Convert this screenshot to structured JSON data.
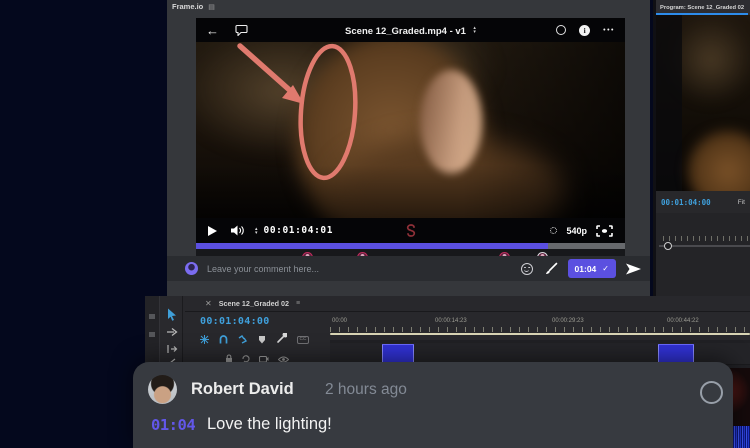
{
  "frameio": {
    "app_title": "Frame.io",
    "player": {
      "title": "Scene 12_Graded.mp4 - v1",
      "timecode": "00:01:04:01",
      "quality": "540p",
      "progress_percent": 82,
      "markers": [
        {
          "position_percent": 24.6,
          "ring_color": "#c02c5e"
        },
        {
          "position_percent": 37.6,
          "ring_color": "#c02c5e"
        },
        {
          "position_percent": 70.7,
          "ring_color": "#c02c5e"
        },
        {
          "position_percent": 79.6,
          "ring_color": "#d8dade"
        }
      ]
    },
    "comment_bar": {
      "placeholder": "Leave your comment here...",
      "timestamp_chip": "01:04",
      "chip_check": "✓"
    }
  },
  "premiere": {
    "timeline": {
      "tab_label": "Scene 12_Graded 02",
      "timecode": "00:01:04:00",
      "cc_label": "CC",
      "ruler_labels": [
        "00:00",
        "00:00:14:23",
        "00:00:29:23",
        "00:00:44:22"
      ],
      "clips": [
        {
          "left_percent": 12.4,
          "width_percent": 7.6
        },
        {
          "left_percent": 78.1,
          "width_percent": 8.6
        }
      ]
    },
    "program": {
      "tab_label": "Program: Scene 12_Graded 02",
      "timecode": "00:01:04:00",
      "zoom_level": "Fit"
    }
  },
  "comment_card": {
    "author": "Robert David",
    "time_ago": "2 hours ago",
    "timestamp": "01:04",
    "text": "Love the lighting!"
  },
  "colors": {
    "accent_purple": "#5b50e0",
    "comment_purple": "#6257e9",
    "timecode_blue": "#3fa0dc",
    "clip_blue": "#3132d6",
    "annotation_salmon": "#e07a6e",
    "marker_ring_pink": "#c02c5e",
    "desktop_navy": "#04081d"
  }
}
